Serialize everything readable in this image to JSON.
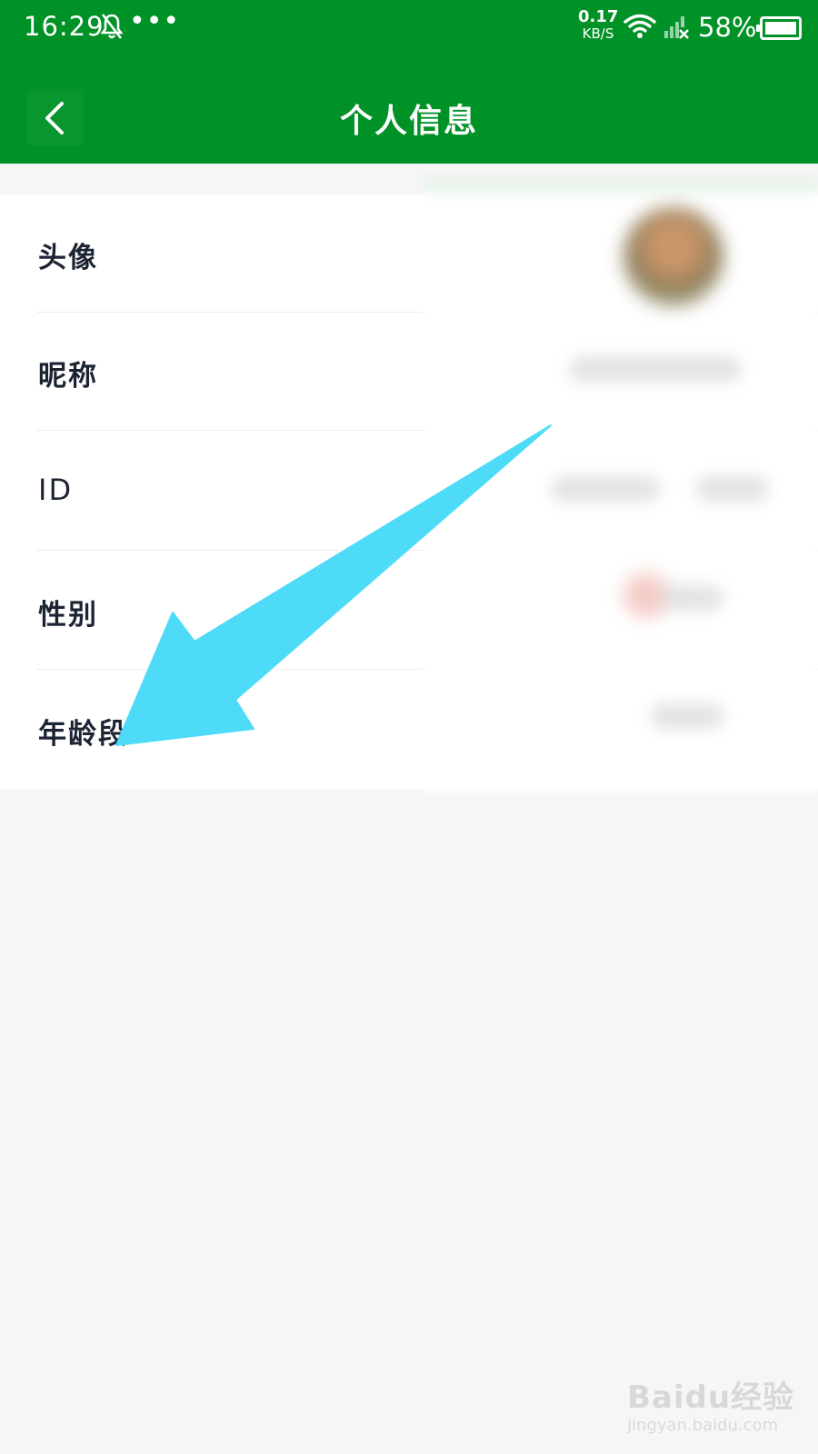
{
  "status_bar": {
    "time": "16:29",
    "dots": "•••",
    "net_speed_value": "0.17",
    "net_speed_unit": "KB/S",
    "battery_percent": "58%"
  },
  "header": {
    "title": "个人信息",
    "back_icon": "chevron-left-icon"
  },
  "profile_rows": [
    {
      "label": "头像"
    },
    {
      "label": "昵称"
    },
    {
      "label": "ID"
    },
    {
      "label": "性别"
    },
    {
      "label": "年龄段"
    }
  ],
  "watermark": {
    "brand": "Baidu经验",
    "url": "jingyan.baidu.com"
  },
  "colors": {
    "header_green": "#009227",
    "arrow_blue": "#4ddbf8",
    "background": "#f6f6f6"
  }
}
